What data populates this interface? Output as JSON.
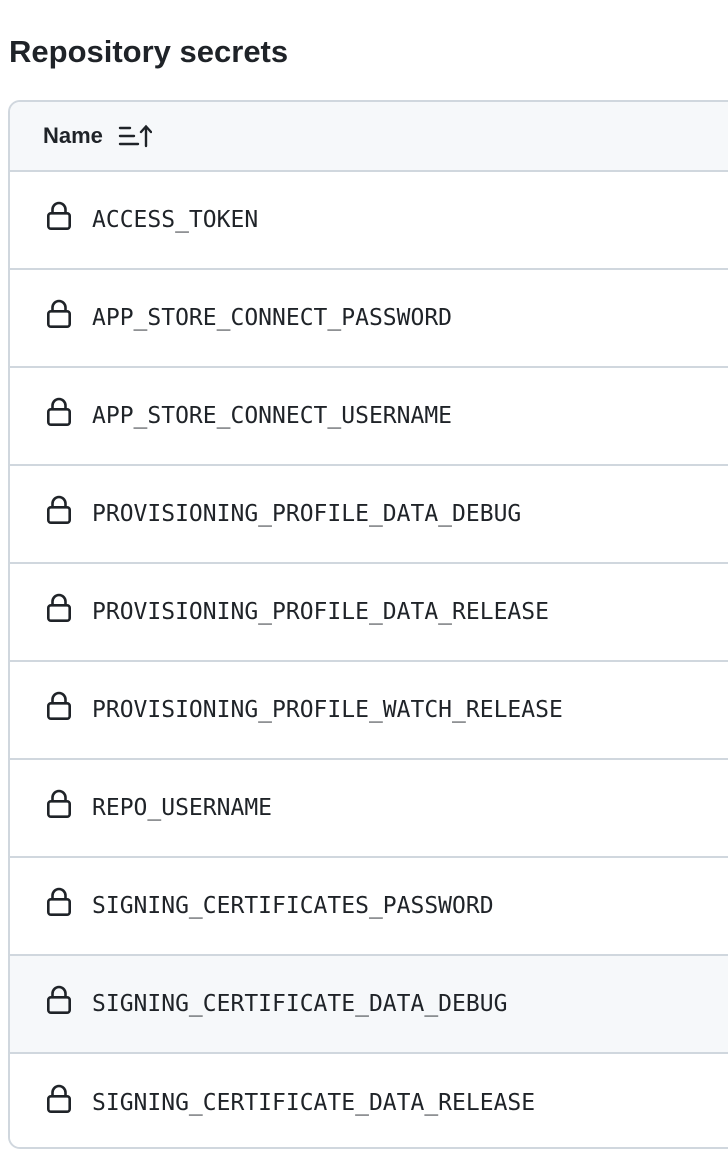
{
  "page": {
    "title": "Repository secrets"
  },
  "table": {
    "header": {
      "name_label": "Name",
      "sort_icon": "sort-ascending-icon"
    },
    "row_icon": "lock-icon",
    "rows": [
      {
        "name": "ACCESS_TOKEN"
      },
      {
        "name": "APP_STORE_CONNECT_PASSWORD"
      },
      {
        "name": "APP_STORE_CONNECT_USERNAME"
      },
      {
        "name": "PROVISIONING_PROFILE_DATA_DEBUG"
      },
      {
        "name": "PROVISIONING_PROFILE_DATA_RELEASE"
      },
      {
        "name": "PROVISIONING_PROFILE_WATCH_RELEASE"
      },
      {
        "name": "REPO_USERNAME"
      },
      {
        "name": "SIGNING_CERTIFICATES_PASSWORD"
      },
      {
        "name": "SIGNING_CERTIFICATE_DATA_DEBUG"
      },
      {
        "name": "SIGNING_CERTIFICATE_DATA_RELEASE"
      }
    ]
  },
  "colors": {
    "text": "#1f2328",
    "border": "#d0d7de",
    "header_bg": "#f6f8fa",
    "hover_bg": "#f6f8fa"
  }
}
